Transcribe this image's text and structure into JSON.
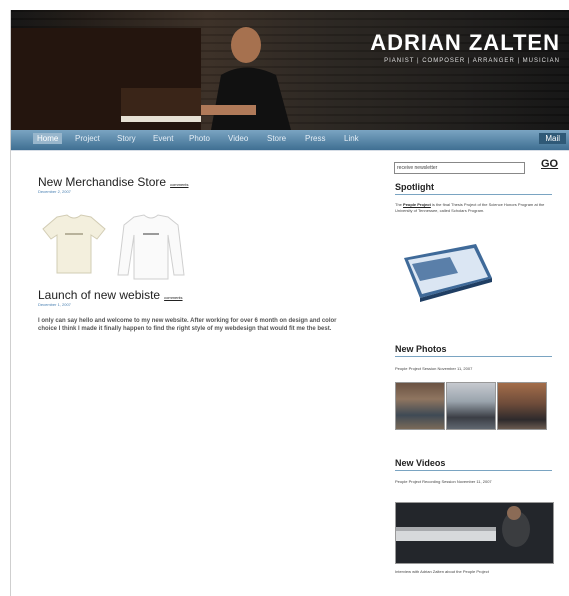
{
  "header": {
    "title": "ADRIAN ZALTEN",
    "subtitle": "PIANIST | COMPOSER | ARRANGER | MUSICIAN"
  },
  "nav": {
    "items": [
      "Home",
      "Project",
      "Story",
      "Event",
      "Photo",
      "Video",
      "Store",
      "Press",
      "Link"
    ],
    "active": "Home",
    "right": "Mail"
  },
  "posts": [
    {
      "title": "New Merchandise Store",
      "comments": "comments",
      "date": "December 2, 2007"
    },
    {
      "title": "Launch of new webiste",
      "comments": "comments",
      "date": "December 1, 2007",
      "body": "I only can say hello and welcome to my new website. After working for over 6 month on design and color choice I think I made it finally happen to find the right style of my webdesign that would fit me the best."
    }
  ],
  "sidebar": {
    "newsletter_value": "receive newsletter",
    "go_label": "GO",
    "spotlight": {
      "heading": "Spotlight",
      "text_prefix": "The",
      "link": "People Project",
      "text_suffix": "is the final Thesis Project of the Science Honors Program at the University of Tennessee, called Scholars Program."
    },
    "photos": {
      "heading": "New Photos",
      "caption": "People Project Session November 11, 2007"
    },
    "videos": {
      "heading": "New Videos",
      "caption": "People Project Recording Session November 11, 2007",
      "footer_caption": "Interview with Adrian Zalten about the People Project"
    }
  },
  "colors": {
    "nav_blue": "#5a86a8",
    "accent_link": "#4a80b2"
  }
}
